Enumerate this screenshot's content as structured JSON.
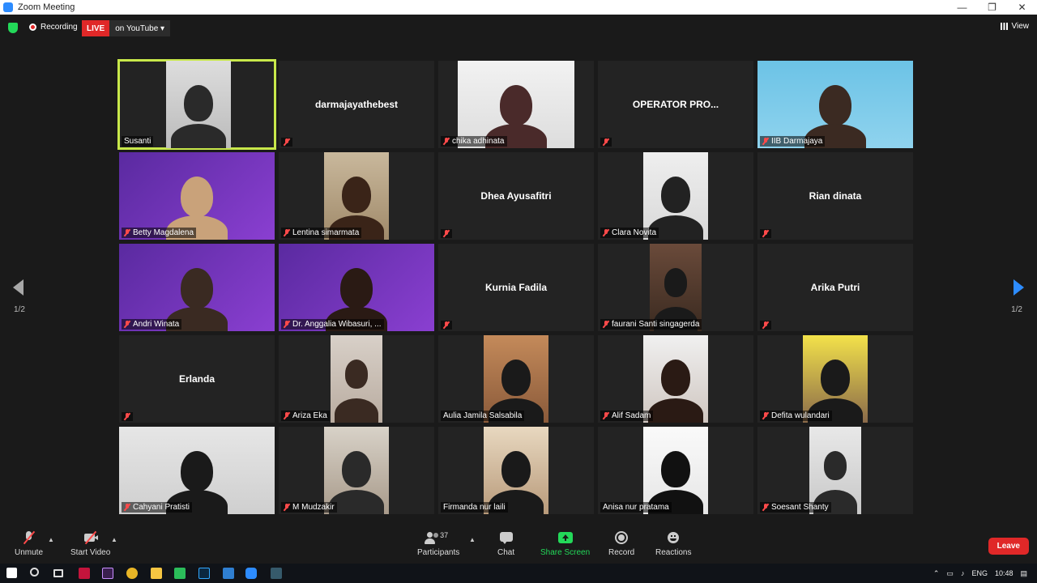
{
  "window": {
    "title": "Zoom Meeting",
    "controls": [
      "—",
      "❐",
      "✕"
    ]
  },
  "topbar": {
    "recording_label": "Recording",
    "live_badge": "LIVE",
    "stream_label": "on YouTube ▾",
    "view_label": "View"
  },
  "participants": [
    {
      "name": "Susanti",
      "video": true,
      "muted": false,
      "active": true
    },
    {
      "name": "darmajayathebest",
      "video": false,
      "muted": true
    },
    {
      "name": "chika adhinata",
      "video": true,
      "muted": true
    },
    {
      "name": "OPERATOR  PRO...",
      "video": false,
      "muted": true
    },
    {
      "name": "IIB Darmajaya",
      "video": true,
      "muted": true
    },
    {
      "name": "Betty Magdalena",
      "video": true,
      "muted": true
    },
    {
      "name": "Lentina simarmata",
      "video": true,
      "muted": true
    },
    {
      "name": "Dhea Ayusafitri",
      "video": false,
      "muted": true
    },
    {
      "name": "Clara Novita",
      "video": true,
      "muted": true
    },
    {
      "name": "Rian dinata",
      "video": false,
      "muted": true
    },
    {
      "name": "Andri Winata",
      "video": true,
      "muted": true
    },
    {
      "name": "Dr. Anggalia Wibasuri, ...",
      "video": true,
      "muted": true
    },
    {
      "name": "Kurnia Fadila",
      "video": false,
      "muted": true
    },
    {
      "name": "faurani Santi singagerda",
      "video": true,
      "muted": true
    },
    {
      "name": "Arika Putri",
      "video": false,
      "muted": true
    },
    {
      "name": "Erlanda",
      "video": false,
      "muted": true
    },
    {
      "name": "Ariza Eka",
      "video": true,
      "muted": true
    },
    {
      "name": "Aulia Jamila Salsabila",
      "video": true,
      "muted": false
    },
    {
      "name": "Alif Sadam",
      "video": true,
      "muted": true
    },
    {
      "name": "Defita wulandari",
      "video": true,
      "muted": true
    },
    {
      "name": "Cahyani Pratisti",
      "video": true,
      "muted": true
    },
    {
      "name": "M Mudzakir",
      "video": true,
      "muted": true
    },
    {
      "name": "Firmanda nur laili",
      "video": true,
      "muted": false
    },
    {
      "name": "Anisa nur pratama",
      "video": true,
      "muted": false
    },
    {
      "name": "Soesant Shanty",
      "video": true,
      "muted": true
    }
  ],
  "pagination": {
    "left": "1/2",
    "right": "1/2"
  },
  "toolbar": {
    "unmute": "Unmute",
    "start_video": "Start Video",
    "participants": "Participants",
    "participants_count": "37",
    "chat": "Chat",
    "share_screen": "Share Screen",
    "record": "Record",
    "reactions": "Reactions",
    "leave": "Leave"
  },
  "taskbar": {
    "lang": "ENG",
    "time": "10:48"
  },
  "colors": {
    "accent": "#2d8cff",
    "share_green": "#23d959",
    "leave_red": "#e02828",
    "active_border": "#c8e84a"
  }
}
